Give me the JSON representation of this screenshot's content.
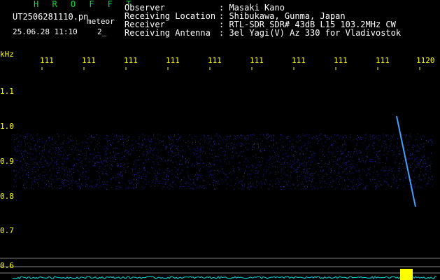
{
  "header": {
    "title": "H R O F F T",
    "filename": "UT2506281110.pn",
    "label_type": "meteor",
    "datetime": "25.06.28 11:10",
    "counter": "2_"
  },
  "info": [
    {
      "key": "Observer",
      "value": ": Masaki Kano"
    },
    {
      "key": "Receiving Location",
      "value": ": Shibukawa, Gunma, Japan"
    },
    {
      "key": "Receiver",
      "value": ": RTL-SDR SDR# 43dB L15 103.2MHz CW"
    },
    {
      "key": "Receiving Antenna",
      "value": ": 3el Yagi(V) Az 330 for Vladivostok"
    }
  ],
  "axis": {
    "y_unit": "kHz",
    "x_ticks": [
      "111",
      "111",
      "111",
      "111",
      "111",
      "111",
      "111",
      "111",
      "111",
      "1120"
    ],
    "y_ticks": [
      "1.1",
      "1.0",
      "0.9",
      "0.8",
      "0.7",
      "0.6"
    ]
  },
  "colors": {
    "text_green": "#00e040",
    "text_white": "#ffffff",
    "text_yellow": "#ffff00",
    "noise_blue": "#2020a0",
    "meteor_blue": "#40a0ff",
    "spectrum_cyan": "#00e0e0",
    "baseline_gray": "#808080"
  },
  "signal": {
    "meteor_start_khz": 1.03,
    "meteor_end_khz": 0.77,
    "noise_band_khz": [
      0.82,
      0.98
    ]
  }
}
